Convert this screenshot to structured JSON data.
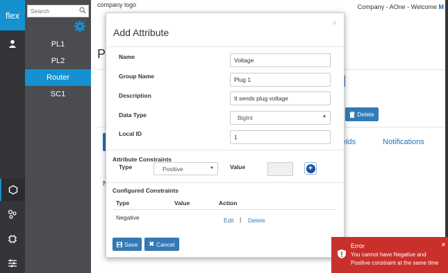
{
  "brand": "flex",
  "search": {
    "placeholder": "Search"
  },
  "nav": {
    "items": [
      "PL1",
      "PL2",
      "Router",
      "SC1"
    ],
    "active": "Router"
  },
  "header": {
    "logo_text": "company logo",
    "welcome_text": "Company - AOne - Welcome",
    "welcome_suffix": "M"
  },
  "background": {
    "page_initial": "P",
    "delete_label": "Delete",
    "tab_fields_partial": "elds",
    "tab_notifications": "Notifications",
    "list_initial": "N"
  },
  "modal": {
    "title": "Add Attribute",
    "close": "×",
    "fields": {
      "name": {
        "label": "Name",
        "value": "Voltage"
      },
      "group_name": {
        "label": "Group Name",
        "value": "Plug 1"
      },
      "description": {
        "label": "Description",
        "value": "It sends plug voltage"
      },
      "data_type": {
        "label": "Data Type",
        "value": "BigInt"
      },
      "local_id": {
        "label": "Local ID",
        "value": "1"
      }
    },
    "constraints": {
      "title": "Attribute Constraints",
      "type_label": "Type",
      "type_value": "Positive",
      "value_label": "Value",
      "value_value": ""
    },
    "configured": {
      "title": "Configured Constraints",
      "headers": [
        "Type",
        "Value",
        "Action"
      ],
      "rows": [
        {
          "type": "Negative",
          "value": "",
          "edit": "Edit",
          "separator": "|",
          "delete": "Delete"
        }
      ]
    },
    "save_label": "Save",
    "cancel_label": "Cancel"
  },
  "toast": {
    "title": "Error",
    "message": "You cannot have Negative and Positive constraint at the same time",
    "close": "×",
    "color": "#c9302c"
  },
  "colors": {
    "accent": "#1591cf",
    "rail": "#333538",
    "subnav": "#4a4c4f",
    "primary_button": "#337ab7"
  }
}
